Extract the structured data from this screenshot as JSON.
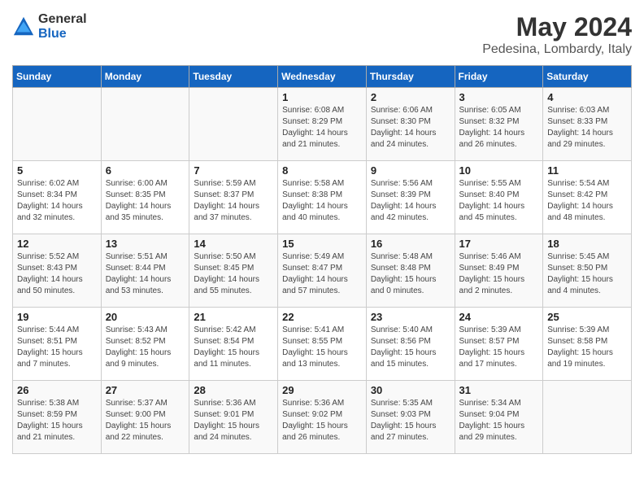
{
  "logo": {
    "general": "General",
    "blue": "Blue"
  },
  "title": {
    "month_year": "May 2024",
    "location": "Pedesina, Lombardy, Italy"
  },
  "days_of_week": [
    "Sunday",
    "Monday",
    "Tuesday",
    "Wednesday",
    "Thursday",
    "Friday",
    "Saturday"
  ],
  "weeks": [
    [
      {
        "day": "",
        "info": ""
      },
      {
        "day": "",
        "info": ""
      },
      {
        "day": "",
        "info": ""
      },
      {
        "day": "1",
        "info": "Sunrise: 6:08 AM\nSunset: 8:29 PM\nDaylight: 14 hours\nand 21 minutes."
      },
      {
        "day": "2",
        "info": "Sunrise: 6:06 AM\nSunset: 8:30 PM\nDaylight: 14 hours\nand 24 minutes."
      },
      {
        "day": "3",
        "info": "Sunrise: 6:05 AM\nSunset: 8:32 PM\nDaylight: 14 hours\nand 26 minutes."
      },
      {
        "day": "4",
        "info": "Sunrise: 6:03 AM\nSunset: 8:33 PM\nDaylight: 14 hours\nand 29 minutes."
      }
    ],
    [
      {
        "day": "5",
        "info": "Sunrise: 6:02 AM\nSunset: 8:34 PM\nDaylight: 14 hours\nand 32 minutes."
      },
      {
        "day": "6",
        "info": "Sunrise: 6:00 AM\nSunset: 8:35 PM\nDaylight: 14 hours\nand 35 minutes."
      },
      {
        "day": "7",
        "info": "Sunrise: 5:59 AM\nSunset: 8:37 PM\nDaylight: 14 hours\nand 37 minutes."
      },
      {
        "day": "8",
        "info": "Sunrise: 5:58 AM\nSunset: 8:38 PM\nDaylight: 14 hours\nand 40 minutes."
      },
      {
        "day": "9",
        "info": "Sunrise: 5:56 AM\nSunset: 8:39 PM\nDaylight: 14 hours\nand 42 minutes."
      },
      {
        "day": "10",
        "info": "Sunrise: 5:55 AM\nSunset: 8:40 PM\nDaylight: 14 hours\nand 45 minutes."
      },
      {
        "day": "11",
        "info": "Sunrise: 5:54 AM\nSunset: 8:42 PM\nDaylight: 14 hours\nand 48 minutes."
      }
    ],
    [
      {
        "day": "12",
        "info": "Sunrise: 5:52 AM\nSunset: 8:43 PM\nDaylight: 14 hours\nand 50 minutes."
      },
      {
        "day": "13",
        "info": "Sunrise: 5:51 AM\nSunset: 8:44 PM\nDaylight: 14 hours\nand 53 minutes."
      },
      {
        "day": "14",
        "info": "Sunrise: 5:50 AM\nSunset: 8:45 PM\nDaylight: 14 hours\nand 55 minutes."
      },
      {
        "day": "15",
        "info": "Sunrise: 5:49 AM\nSunset: 8:47 PM\nDaylight: 14 hours\nand 57 minutes."
      },
      {
        "day": "16",
        "info": "Sunrise: 5:48 AM\nSunset: 8:48 PM\nDaylight: 15 hours\nand 0 minutes."
      },
      {
        "day": "17",
        "info": "Sunrise: 5:46 AM\nSunset: 8:49 PM\nDaylight: 15 hours\nand 2 minutes."
      },
      {
        "day": "18",
        "info": "Sunrise: 5:45 AM\nSunset: 8:50 PM\nDaylight: 15 hours\nand 4 minutes."
      }
    ],
    [
      {
        "day": "19",
        "info": "Sunrise: 5:44 AM\nSunset: 8:51 PM\nDaylight: 15 hours\nand 7 minutes."
      },
      {
        "day": "20",
        "info": "Sunrise: 5:43 AM\nSunset: 8:52 PM\nDaylight: 15 hours\nand 9 minutes."
      },
      {
        "day": "21",
        "info": "Sunrise: 5:42 AM\nSunset: 8:54 PM\nDaylight: 15 hours\nand 11 minutes."
      },
      {
        "day": "22",
        "info": "Sunrise: 5:41 AM\nSunset: 8:55 PM\nDaylight: 15 hours\nand 13 minutes."
      },
      {
        "day": "23",
        "info": "Sunrise: 5:40 AM\nSunset: 8:56 PM\nDaylight: 15 hours\nand 15 minutes."
      },
      {
        "day": "24",
        "info": "Sunrise: 5:39 AM\nSunset: 8:57 PM\nDaylight: 15 hours\nand 17 minutes."
      },
      {
        "day": "25",
        "info": "Sunrise: 5:39 AM\nSunset: 8:58 PM\nDaylight: 15 hours\nand 19 minutes."
      }
    ],
    [
      {
        "day": "26",
        "info": "Sunrise: 5:38 AM\nSunset: 8:59 PM\nDaylight: 15 hours\nand 21 minutes."
      },
      {
        "day": "27",
        "info": "Sunrise: 5:37 AM\nSunset: 9:00 PM\nDaylight: 15 hours\nand 22 minutes."
      },
      {
        "day": "28",
        "info": "Sunrise: 5:36 AM\nSunset: 9:01 PM\nDaylight: 15 hours\nand 24 minutes."
      },
      {
        "day": "29",
        "info": "Sunrise: 5:36 AM\nSunset: 9:02 PM\nDaylight: 15 hours\nand 26 minutes."
      },
      {
        "day": "30",
        "info": "Sunrise: 5:35 AM\nSunset: 9:03 PM\nDaylight: 15 hours\nand 27 minutes."
      },
      {
        "day": "31",
        "info": "Sunrise: 5:34 AM\nSunset: 9:04 PM\nDaylight: 15 hours\nand 29 minutes."
      },
      {
        "day": "",
        "info": ""
      }
    ]
  ]
}
